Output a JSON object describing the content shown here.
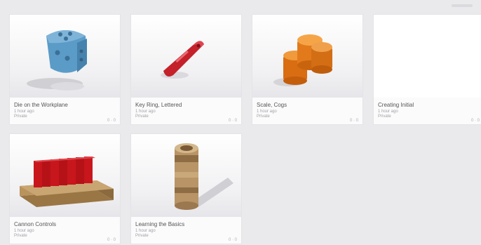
{
  "designs": [
    {
      "title": "Die on the Workplane",
      "subtitle": "1 hour ago",
      "privacy": "Private",
      "stats": "0 · 0"
    },
    {
      "title": "Key Ring, Lettered",
      "subtitle": "1 hour ago",
      "privacy": "Private",
      "stats": "0 · 0"
    },
    {
      "title": "Scale, Cogs",
      "subtitle": "1 hour ago",
      "privacy": "Private",
      "stats": "0 · 0"
    },
    {
      "title": "Creating Initial",
      "subtitle": "1 hour ago",
      "privacy": "Private",
      "stats": "0 · 0"
    },
    {
      "title": "Cannon Controls",
      "subtitle": "1 hour ago",
      "privacy": "Private",
      "stats": "0 · 0"
    },
    {
      "title": "Learning the Basics",
      "subtitle": "1 hour ago",
      "privacy": "Private",
      "stats": "0 · 0"
    }
  ],
  "colors": {
    "background": "#eaeaec",
    "card": "#fbfbfc",
    "die": "#5b9bc7",
    "keyring": "#c4212b",
    "cogs": "#e27a1b",
    "wall_red": "#c8161d",
    "wood": "#b9935c"
  },
  "icons": [
    "die-model-icon",
    "key-ring-model-icon",
    "cogs-model-icon",
    "blank-thumbnail",
    "wall-model-icon",
    "cylinder-model-icon"
  ]
}
